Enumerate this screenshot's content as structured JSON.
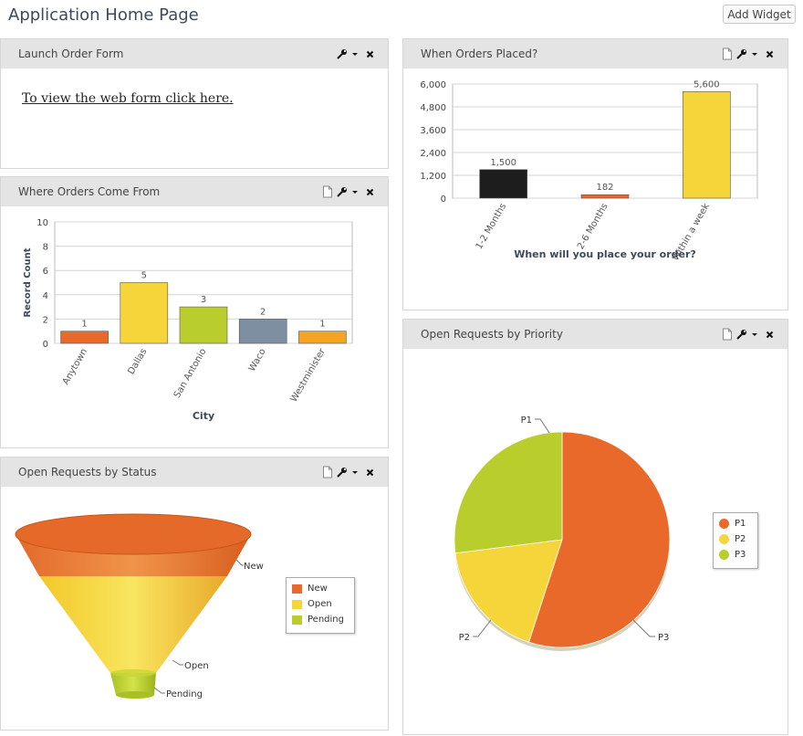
{
  "page": {
    "title": "Application Home Page",
    "add_widget_label": "Add Widget"
  },
  "widgets": {
    "launch": {
      "title": "Launch Order Form",
      "link_text": "To view the web form click here."
    },
    "where": {
      "title": "Where Orders Come From"
    },
    "status": {
      "title": "Open Requests by Status"
    },
    "when": {
      "title": "When Orders Placed?"
    },
    "priority": {
      "title": "Open Requests by Priority"
    }
  },
  "icons": {
    "doc": "document-icon",
    "wrench": "wrench-icon",
    "menu": "chevron-down-icon",
    "close": "close-icon"
  },
  "chart_data": [
    {
      "id": "where",
      "type": "bar",
      "categories": [
        "Anytown",
        "Dallas",
        "San Antonio",
        "Waco",
        "Westminister"
      ],
      "values": [
        1,
        5,
        3,
        2,
        1
      ],
      "colors": [
        "#e8692a",
        "#f6d53a",
        "#b9cd2c",
        "#7d8fa0",
        "#f3a521"
      ],
      "xlabel": "City",
      "ylabel": "Record Count",
      "ylim": [
        0,
        10
      ],
      "yticks": [
        0,
        2,
        4,
        6,
        8,
        10
      ],
      "grid": true
    },
    {
      "id": "when",
      "type": "bar",
      "categories": [
        "1-2 Months",
        "2-6 Months",
        "Within a week"
      ],
      "values": [
        1500,
        182,
        5600
      ],
      "value_labels": [
        "1,500",
        "182",
        "5,600"
      ],
      "colors": [
        "#1d1d1d",
        "#e8692a",
        "#f6d53a"
      ],
      "xlabel": "When will you place your order?",
      "ylabel": "",
      "ylim": [
        0,
        6000
      ],
      "yticks": [
        "0",
        "1,200",
        "2,400",
        "3,600",
        "4,800",
        "6,000"
      ],
      "grid": true
    },
    {
      "id": "status",
      "type": "funnel",
      "categories": [
        "New",
        "Open",
        "Pending"
      ],
      "colors": [
        "#e8692a",
        "#f6d53a",
        "#b9cd2c"
      ],
      "legend_position": "right"
    },
    {
      "id": "priority",
      "type": "pie",
      "categories": [
        "P1",
        "P2",
        "P3"
      ],
      "values": [
        0.55,
        0.18,
        0.27
      ],
      "colors": [
        "#e8692a",
        "#f6d53a",
        "#b9cd2c"
      ],
      "legend_position": "right"
    }
  ]
}
